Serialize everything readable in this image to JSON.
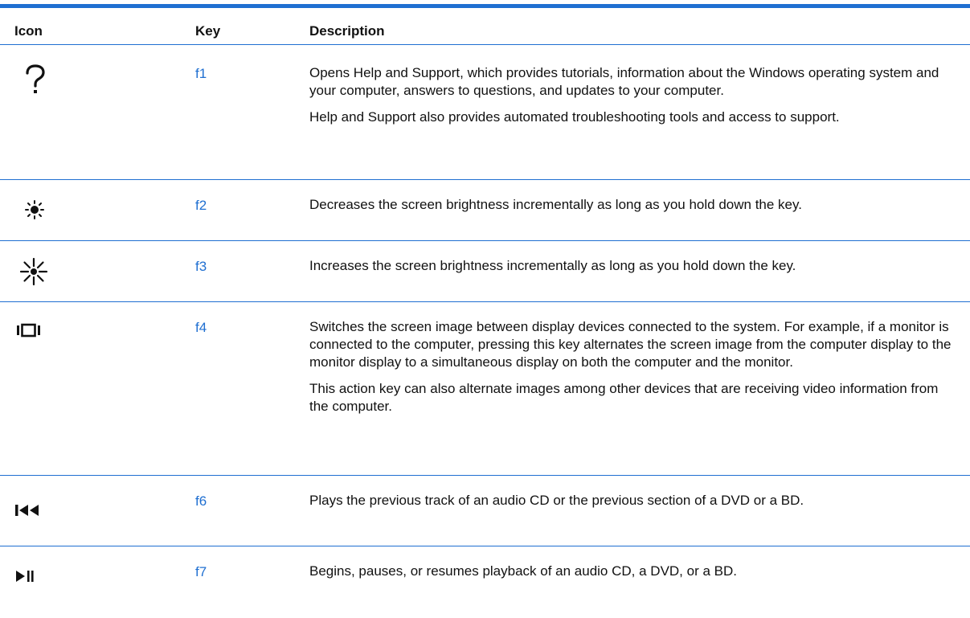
{
  "table": {
    "headers": {
      "icon": "Icon",
      "key": "Key",
      "description": "Description"
    },
    "rows": [
      {
        "icon": "question-mark-icon",
        "key": "f1",
        "paragraphs": [
          "Opens Help and Support, which provides tutorials, information about the Windows operating system and your computer, answers to questions, and updates to your computer.",
          "Help and Support also provides automated troubleshooting tools and access to support."
        ]
      },
      {
        "icon": "brightness-down-icon",
        "key": "f2",
        "paragraphs": [
          "Decreases the screen brightness incrementally as long as you hold down the key."
        ]
      },
      {
        "icon": "brightness-up-icon",
        "key": "f3",
        "paragraphs": [
          "Increases the screen brightness incrementally as long as you hold down the key."
        ]
      },
      {
        "icon": "switch-display-icon",
        "key": "f4",
        "paragraphs": [
          "Switches the screen image between display devices connected to the system. For example, if a monitor is connected to the computer, pressing this key alternates the screen image from the computer display to the monitor display to a simultaneous display on both the computer and the monitor.",
          "This action key can also alternate images among other devices that are receiving video information from the computer."
        ]
      },
      {
        "icon": "previous-track-icon",
        "key": "f6",
        "paragraphs": [
          "Plays the previous track of an audio CD or the previous section of a DVD or a BD."
        ]
      },
      {
        "icon": "play-pause-icon",
        "key": "f7",
        "paragraphs": [
          "Begins, pauses, or resumes playback of an audio CD, a DVD, or a BD."
        ]
      }
    ]
  },
  "colors": {
    "rule": "#1f6fd1",
    "key_text": "#1f6fd1",
    "body_text": "#111111"
  }
}
